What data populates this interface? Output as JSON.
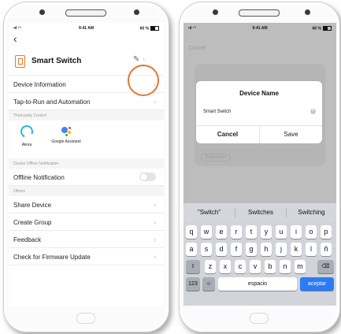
{
  "left_screen": {
    "status": {
      "time": "9:41 AM",
      "battery": "60 %"
    },
    "back_glyph": "‹",
    "device_title": "Smart Switch",
    "rows": [
      {
        "label": "Device Information"
      },
      {
        "label": "Tap-to-Run and Automation"
      }
    ],
    "third_party_header": "Third-party Control",
    "integrations": [
      {
        "label": "Alexa"
      },
      {
        "label": "Google Assistant"
      }
    ],
    "offline_header": "Device Offline Notification",
    "offline_label": "Offline Notification",
    "offline_enabled": false,
    "others_header": "Others",
    "other_rows": [
      {
        "label": "Share Device"
      },
      {
        "label": "Create Group"
      },
      {
        "label": "Feedback"
      },
      {
        "label": "Check for Firmware Update"
      }
    ],
    "highlight_color": "#e8762d"
  },
  "right_screen": {
    "status": {
      "time": "9:41 AM",
      "battery": "60 %"
    },
    "cancel_bg": "Cancel",
    "dialog": {
      "title": "Device Name",
      "input_value": "Smart Switch",
      "cancel_label": "Cancel",
      "save_label": "Save"
    },
    "bg_tag": "Bathroom",
    "suggestions": [
      "\"Switch\"",
      "Switches",
      "Switching"
    ],
    "rows": [
      [
        "q",
        "w",
        "e",
        "r",
        "t",
        "y",
        "u",
        "i",
        "o",
        "p"
      ],
      [
        "a",
        "s",
        "d",
        "f",
        "g",
        "h",
        "j",
        "k",
        "l",
        "ñ"
      ],
      [
        "z",
        "x",
        "c",
        "v",
        "b",
        "n",
        "m"
      ]
    ],
    "numbers_key": "123",
    "space_key": "espacio",
    "return_key": "aceptar"
  }
}
